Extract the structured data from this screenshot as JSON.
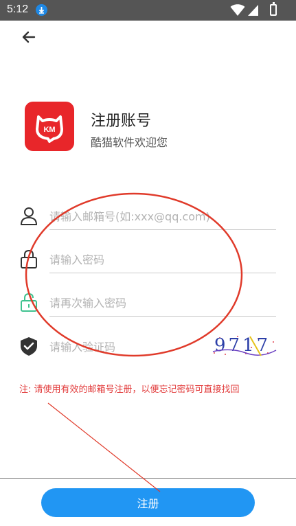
{
  "status_bar": {
    "time": "5:12",
    "icons": [
      "download-icon",
      "wifi-icon",
      "signal-icon",
      "battery-icon"
    ]
  },
  "header": {
    "back_icon": "arrow-left-icon"
  },
  "app": {
    "logo_text": "KM",
    "logo_color": "#e8262a",
    "title": "注册账号",
    "subtitle": "酷猫软件欢迎您"
  },
  "form": {
    "email": {
      "placeholder": "请输入邮箱号(如:xxx@qq.com)",
      "icon": "user-icon"
    },
    "password": {
      "placeholder": "请输入密码",
      "icon": "lock-icon"
    },
    "password_confirm": {
      "placeholder": "请再次输入密码",
      "icon": "lock-open-icon"
    },
    "captcha": {
      "placeholder": "请输入验证码",
      "icon": "shield-check-icon",
      "image_text": "9717"
    }
  },
  "note": "注: 请使用有效的邮箱号注册，以便忘记密码可直接找回",
  "actions": {
    "register_label": "注册",
    "register_color": "#2196f3"
  },
  "annotation_color": "#e03a2a"
}
